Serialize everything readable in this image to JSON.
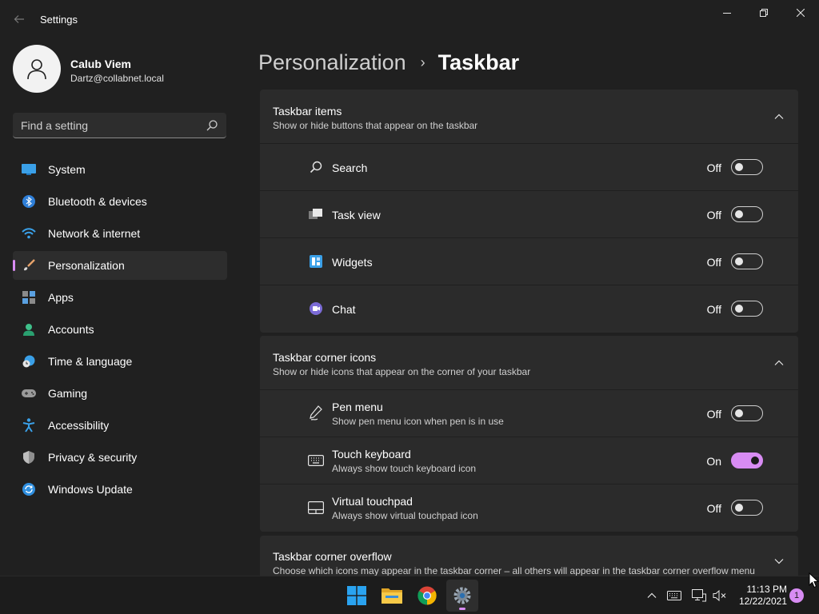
{
  "window": {
    "title": "Settings"
  },
  "profile": {
    "name": "Calub Viem",
    "email": "Dartz@collabnet.local"
  },
  "search": {
    "placeholder": "Find a setting"
  },
  "sidebar": {
    "items": [
      {
        "label": "System",
        "icon": "system-icon"
      },
      {
        "label": "Bluetooth & devices",
        "icon": "bluetooth-icon"
      },
      {
        "label": "Network & internet",
        "icon": "wifi-icon"
      },
      {
        "label": "Personalization",
        "icon": "brush-icon",
        "active": true
      },
      {
        "label": "Apps",
        "icon": "apps-icon"
      },
      {
        "label": "Accounts",
        "icon": "person-icon"
      },
      {
        "label": "Time & language",
        "icon": "clock-globe-icon"
      },
      {
        "label": "Gaming",
        "icon": "gamepad-icon"
      },
      {
        "label": "Accessibility",
        "icon": "accessibility-icon"
      },
      {
        "label": "Privacy & security",
        "icon": "shield-icon"
      },
      {
        "label": "Windows Update",
        "icon": "update-icon"
      }
    ]
  },
  "breadcrumb": {
    "parent": "Personalization",
    "separator": "›",
    "current": "Taskbar"
  },
  "taskbar_items": {
    "title": "Taskbar items",
    "subtitle": "Show or hide buttons that appear on the taskbar",
    "rows": [
      {
        "label": "Search",
        "state": "Off",
        "icon": "search-icon"
      },
      {
        "label": "Task view",
        "state": "Off",
        "icon": "task-view-icon"
      },
      {
        "label": "Widgets",
        "state": "Off",
        "icon": "widgets-icon"
      },
      {
        "label": "Chat",
        "state": "Off",
        "icon": "chat-icon"
      }
    ]
  },
  "corner_icons": {
    "title": "Taskbar corner icons",
    "subtitle": "Show or hide icons that appear on the corner of your taskbar",
    "rows": [
      {
        "label": "Pen menu",
        "desc": "Show pen menu icon when pen is in use",
        "state": "Off",
        "icon": "pen-icon"
      },
      {
        "label": "Touch keyboard",
        "desc": "Always show touch keyboard icon",
        "state": "On",
        "icon": "keyboard-icon"
      },
      {
        "label": "Virtual touchpad",
        "desc": "Always show virtual touchpad icon",
        "state": "Off",
        "icon": "touchpad-icon"
      }
    ]
  },
  "corner_overflow": {
    "title": "Taskbar corner overflow",
    "subtitle": "Choose which icons may appear in the taskbar corner – all others will appear in the taskbar corner overflow menu"
  },
  "system_taskbar": {
    "time": "11:13 PM",
    "date": "12/22/2021",
    "notifications": "1"
  },
  "colors": {
    "accent": "#d88cf3",
    "background": "#202020",
    "card": "#2b2b2b"
  }
}
